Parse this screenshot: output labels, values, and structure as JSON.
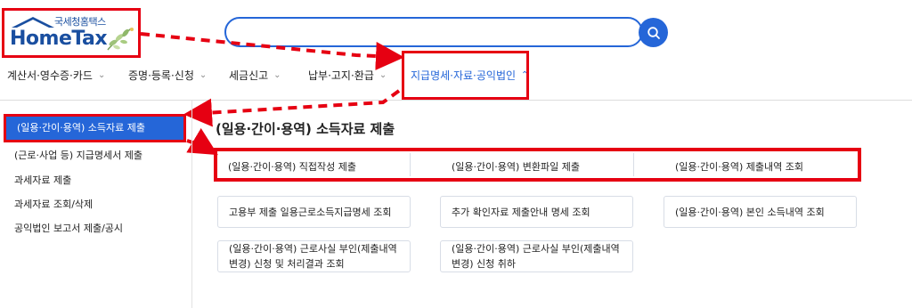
{
  "header": {
    "logo_small": "국세청홈택스",
    "logo_big": "HomeTax",
    "search_placeholder": ""
  },
  "nav": [
    {
      "label": "계산서·영수증·카드"
    },
    {
      "label": "증명·등록·신청"
    },
    {
      "label": "세금신고"
    },
    {
      "label": "납부·고지·환급"
    },
    {
      "label": "지급명세·자료·공익법인",
      "active": true
    }
  ],
  "sidebar": {
    "items": [
      {
        "label": "(일용·간이·용역) 소득자료 제출",
        "active": true
      },
      {
        "label": "(근로·사업 등) 지급명세서 제출"
      },
      {
        "label": "과세자료 제출"
      },
      {
        "label": "과세자료 조회/삭제"
      },
      {
        "label": "공익법인 보고서 제출/공시"
      }
    ]
  },
  "main": {
    "title": "(일용·간이·용역) 소득자료 제출",
    "row1": [
      "(일용·간이·용역) 직접작성 제출",
      "(일용·간이·용역) 변환파일 제출",
      "(일용·간이·용역) 제출내역 조회"
    ],
    "cards": [
      "고용부 제출 일용근로소득지급명세 조회",
      "추가 확인자료 제출안내 명세 조회",
      "(일용·간이·용역) 본인 소득내역 조회",
      "(일용·간이·용역) 근로사실 부인(제출내역 변경) 신청 및 처리결과 조회",
      "(일용·간이·용역) 근로사실 부인(제출내역 변경) 신청 취하"
    ]
  },
  "colors": {
    "accent": "#2566d8",
    "highlight": "#e60012"
  },
  "icons": {
    "search": "search-icon",
    "chevron": "chevron-down-icon",
    "chevron_up": "chevron-up-icon"
  }
}
